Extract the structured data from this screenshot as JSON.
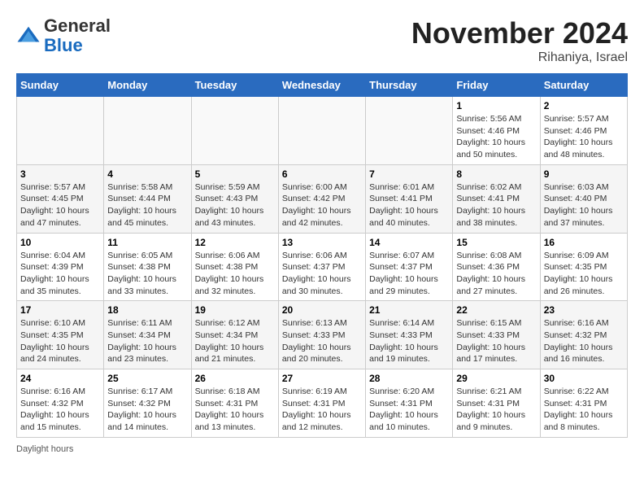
{
  "header": {
    "logo_general": "General",
    "logo_blue": "Blue",
    "month_title": "November 2024",
    "subtitle": "Rihaniya, Israel"
  },
  "days_of_week": [
    "Sunday",
    "Monday",
    "Tuesday",
    "Wednesday",
    "Thursday",
    "Friday",
    "Saturday"
  ],
  "weeks": [
    [
      {
        "day": "",
        "info": ""
      },
      {
        "day": "",
        "info": ""
      },
      {
        "day": "",
        "info": ""
      },
      {
        "day": "",
        "info": ""
      },
      {
        "day": "",
        "info": ""
      },
      {
        "day": "1",
        "info": "Sunrise: 5:56 AM\nSunset: 4:46 PM\nDaylight: 10 hours\nand 50 minutes."
      },
      {
        "day": "2",
        "info": "Sunrise: 5:57 AM\nSunset: 4:46 PM\nDaylight: 10 hours\nand 48 minutes."
      }
    ],
    [
      {
        "day": "3",
        "info": "Sunrise: 5:57 AM\nSunset: 4:45 PM\nDaylight: 10 hours\nand 47 minutes."
      },
      {
        "day": "4",
        "info": "Sunrise: 5:58 AM\nSunset: 4:44 PM\nDaylight: 10 hours\nand 45 minutes."
      },
      {
        "day": "5",
        "info": "Sunrise: 5:59 AM\nSunset: 4:43 PM\nDaylight: 10 hours\nand 43 minutes."
      },
      {
        "day": "6",
        "info": "Sunrise: 6:00 AM\nSunset: 4:42 PM\nDaylight: 10 hours\nand 42 minutes."
      },
      {
        "day": "7",
        "info": "Sunrise: 6:01 AM\nSunset: 4:41 PM\nDaylight: 10 hours\nand 40 minutes."
      },
      {
        "day": "8",
        "info": "Sunrise: 6:02 AM\nSunset: 4:41 PM\nDaylight: 10 hours\nand 38 minutes."
      },
      {
        "day": "9",
        "info": "Sunrise: 6:03 AM\nSunset: 4:40 PM\nDaylight: 10 hours\nand 37 minutes."
      }
    ],
    [
      {
        "day": "10",
        "info": "Sunrise: 6:04 AM\nSunset: 4:39 PM\nDaylight: 10 hours\nand 35 minutes."
      },
      {
        "day": "11",
        "info": "Sunrise: 6:05 AM\nSunset: 4:38 PM\nDaylight: 10 hours\nand 33 minutes."
      },
      {
        "day": "12",
        "info": "Sunrise: 6:06 AM\nSunset: 4:38 PM\nDaylight: 10 hours\nand 32 minutes."
      },
      {
        "day": "13",
        "info": "Sunrise: 6:06 AM\nSunset: 4:37 PM\nDaylight: 10 hours\nand 30 minutes."
      },
      {
        "day": "14",
        "info": "Sunrise: 6:07 AM\nSunset: 4:37 PM\nDaylight: 10 hours\nand 29 minutes."
      },
      {
        "day": "15",
        "info": "Sunrise: 6:08 AM\nSunset: 4:36 PM\nDaylight: 10 hours\nand 27 minutes."
      },
      {
        "day": "16",
        "info": "Sunrise: 6:09 AM\nSunset: 4:35 PM\nDaylight: 10 hours\nand 26 minutes."
      }
    ],
    [
      {
        "day": "17",
        "info": "Sunrise: 6:10 AM\nSunset: 4:35 PM\nDaylight: 10 hours\nand 24 minutes."
      },
      {
        "day": "18",
        "info": "Sunrise: 6:11 AM\nSunset: 4:34 PM\nDaylight: 10 hours\nand 23 minutes."
      },
      {
        "day": "19",
        "info": "Sunrise: 6:12 AM\nSunset: 4:34 PM\nDaylight: 10 hours\nand 21 minutes."
      },
      {
        "day": "20",
        "info": "Sunrise: 6:13 AM\nSunset: 4:33 PM\nDaylight: 10 hours\nand 20 minutes."
      },
      {
        "day": "21",
        "info": "Sunrise: 6:14 AM\nSunset: 4:33 PM\nDaylight: 10 hours\nand 19 minutes."
      },
      {
        "day": "22",
        "info": "Sunrise: 6:15 AM\nSunset: 4:33 PM\nDaylight: 10 hours\nand 17 minutes."
      },
      {
        "day": "23",
        "info": "Sunrise: 6:16 AM\nSunset: 4:32 PM\nDaylight: 10 hours\nand 16 minutes."
      }
    ],
    [
      {
        "day": "24",
        "info": "Sunrise: 6:16 AM\nSunset: 4:32 PM\nDaylight: 10 hours\nand 15 minutes."
      },
      {
        "day": "25",
        "info": "Sunrise: 6:17 AM\nSunset: 4:32 PM\nDaylight: 10 hours\nand 14 minutes."
      },
      {
        "day": "26",
        "info": "Sunrise: 6:18 AM\nSunset: 4:31 PM\nDaylight: 10 hours\nand 13 minutes."
      },
      {
        "day": "27",
        "info": "Sunrise: 6:19 AM\nSunset: 4:31 PM\nDaylight: 10 hours\nand 12 minutes."
      },
      {
        "day": "28",
        "info": "Sunrise: 6:20 AM\nSunset: 4:31 PM\nDaylight: 10 hours\nand 10 minutes."
      },
      {
        "day": "29",
        "info": "Sunrise: 6:21 AM\nSunset: 4:31 PM\nDaylight: 10 hours\nand 9 minutes."
      },
      {
        "day": "30",
        "info": "Sunrise: 6:22 AM\nSunset: 4:31 PM\nDaylight: 10 hours\nand 8 minutes."
      }
    ]
  ],
  "footer": {
    "note": "Daylight hours"
  }
}
